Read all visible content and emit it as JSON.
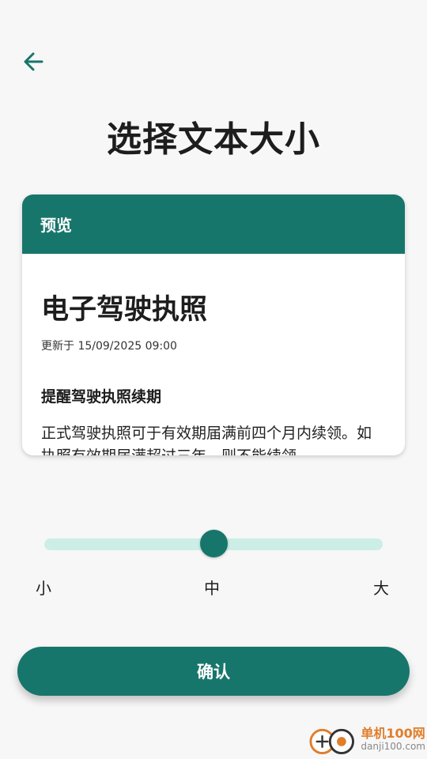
{
  "header": {
    "back_icon": "arrow-left-icon",
    "title": "选择文本大小"
  },
  "preview": {
    "header_label": "预览",
    "doc_title": "电子驾驶执照",
    "updated": "更新于 15/09/2025 09:00",
    "notice_title": "提醒驾驶执照续期",
    "notice_body": "正式驾驶执照可于有效期届满前四个月内续领。如执照有效期届满超过三年，则不能续领。"
  },
  "slider": {
    "labels": [
      "小",
      "中",
      "大"
    ],
    "selected": "中",
    "level": 0.5
  },
  "confirm_label": "确认",
  "watermark": {
    "name": "单机100网",
    "domain": "danji100.com"
  },
  "colors": {
    "primary": "#17766b",
    "track": "#cdeee6",
    "background": "#f7f7f7"
  }
}
